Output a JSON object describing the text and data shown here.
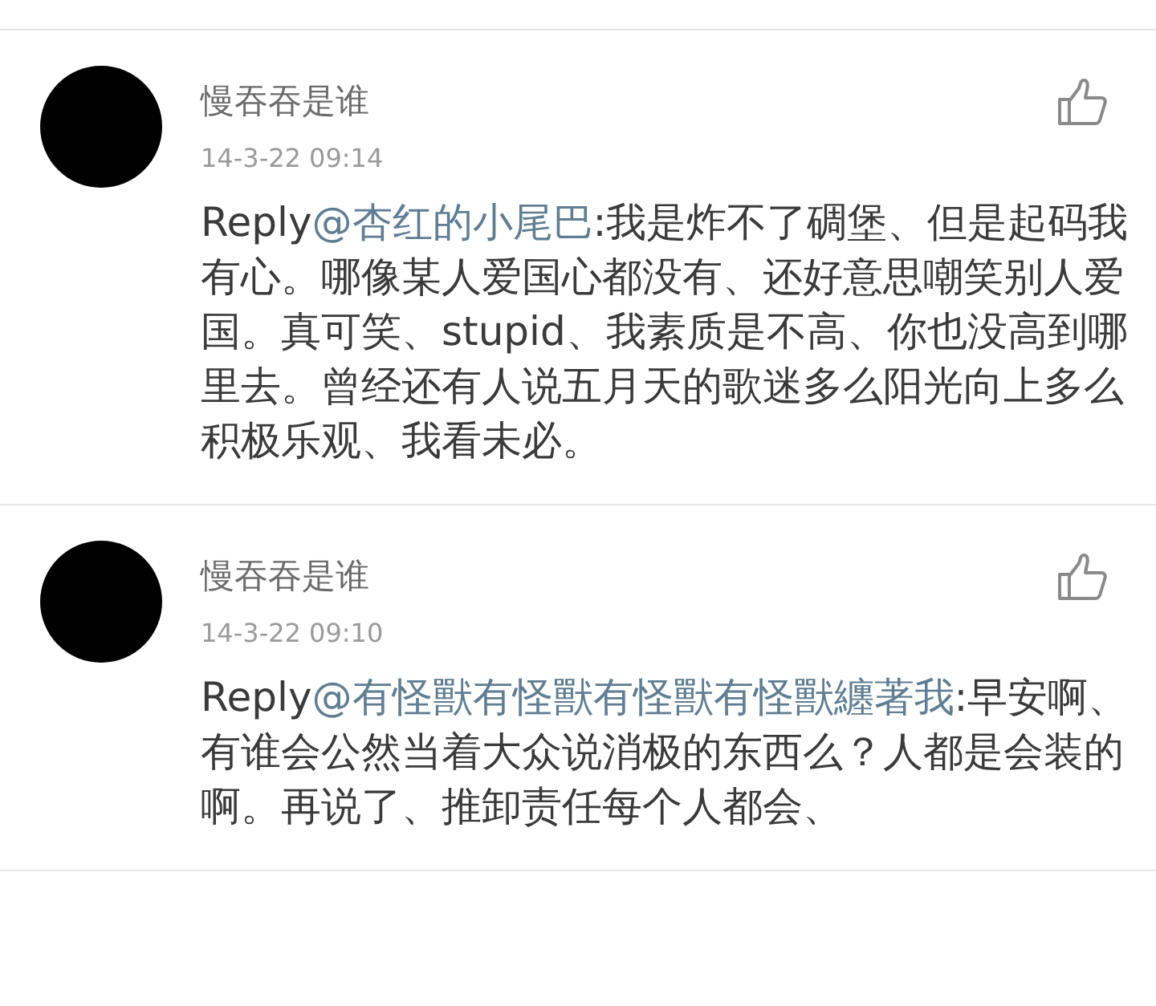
{
  "comments": [
    {
      "author": "慢吞吞是谁",
      "time": "14-3-22 09:14",
      "reply_label": "Reply",
      "mention": "@杏红的小尾巴",
      "text": ":我是炸不了碉堡、但是起码我有心。哪像某人爱国心都没有、还好意思嘲笑别人爱国。真可笑、stupid、我素质是不高、你也没高到哪里去。曾经还有人说五月天的歌迷多么阳光向上多么积极乐观、我看未必。"
    },
    {
      "author": "慢吞吞是谁",
      "time": "14-3-22 09:10",
      "reply_label": "Reply",
      "mention": "@有怪獸有怪獸有怪獸有怪獸纏著我",
      "text": ":早安啊、有谁会公然当着大众说消极的东西么？人都是会装的啊。再说了、推卸责任每个人都会、"
    }
  ]
}
